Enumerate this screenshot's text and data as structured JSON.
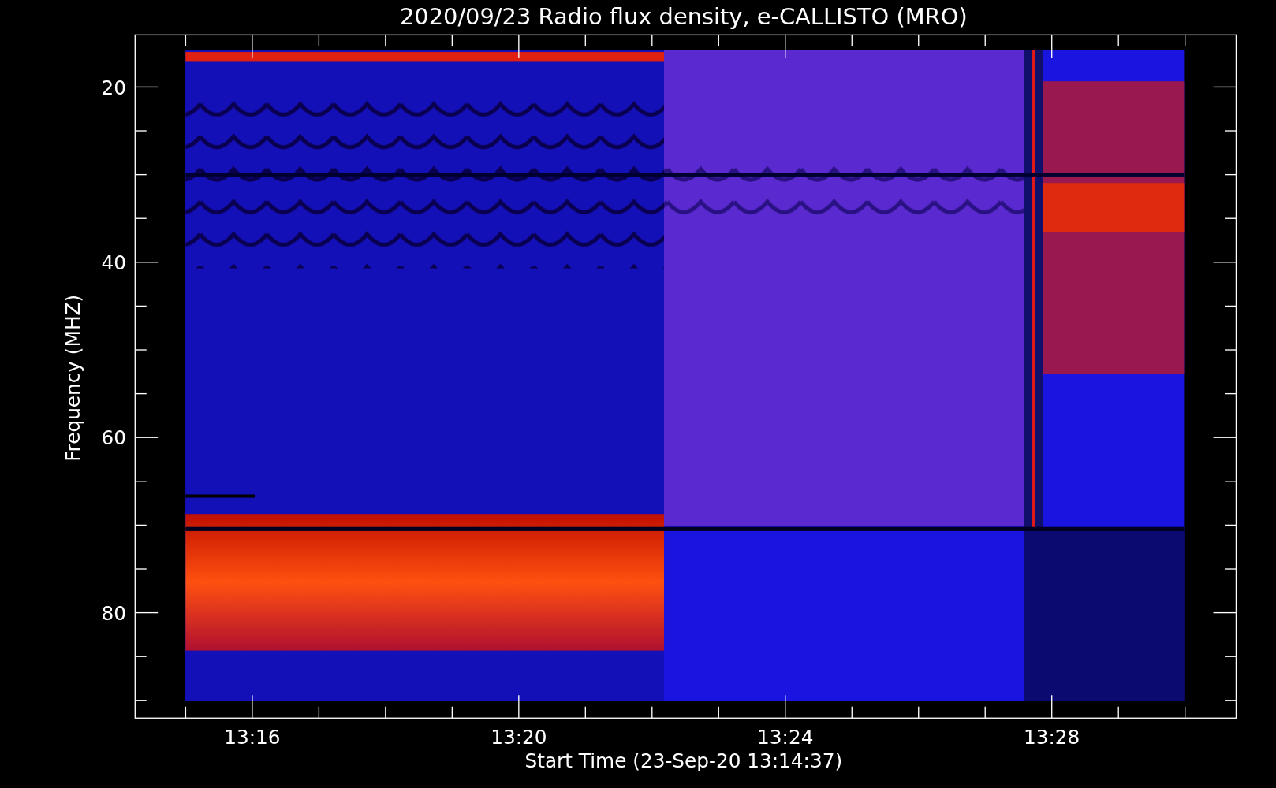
{
  "title": "2020/09/23  Radio flux density, e-CALLISTO (MRO)",
  "y_axis": {
    "label": "Frequency (MHZ)",
    "ticks": [
      "20",
      "40",
      "60",
      "80"
    ]
  },
  "x_axis": {
    "label": "Start Time (23-Sep-20 13:14:37)",
    "ticks": [
      "13:16",
      "13:20",
      "13:24",
      "13:28"
    ]
  }
}
